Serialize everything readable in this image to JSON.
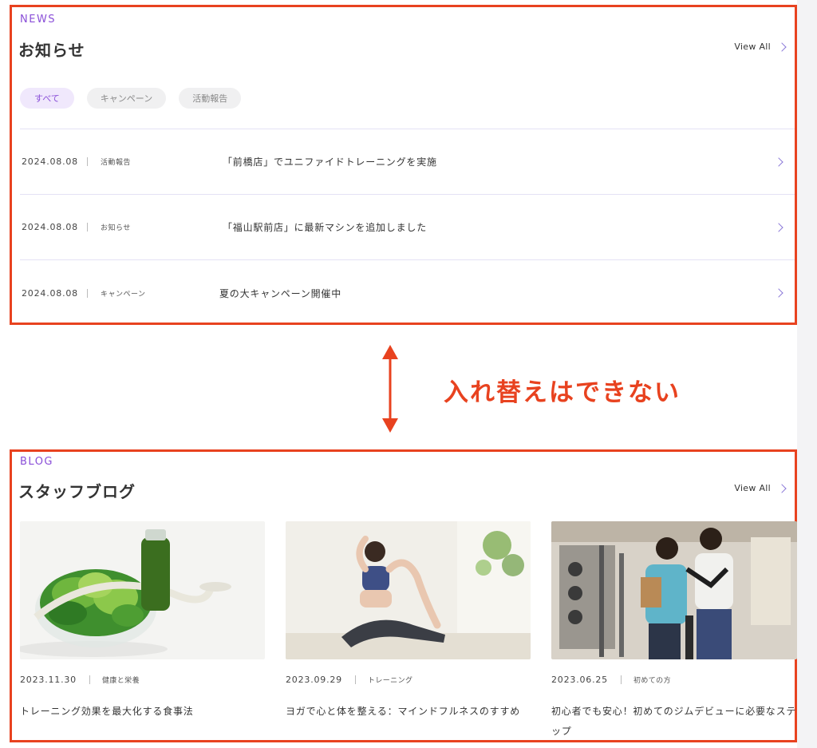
{
  "news": {
    "eyebrow": "NEWS",
    "title": "お知らせ",
    "view_all": "View All",
    "filters": [
      {
        "label": "すべて",
        "active": true
      },
      {
        "label": "キャンペーン",
        "active": false
      },
      {
        "label": "活動報告",
        "active": false
      }
    ],
    "items": [
      {
        "date": "2024.08.08",
        "category": "活動報告",
        "title": "「前橋店」でユニファイドトレーニングを実施"
      },
      {
        "date": "2024.08.08",
        "category": "お知らせ",
        "title": "「福山駅前店」に最新マシンを追加しました"
      },
      {
        "date": "2024.08.08",
        "category": "キャンペーン",
        "title": "夏の大キャンペーン開催中"
      }
    ]
  },
  "annotation": {
    "text": "入れ替えはできない",
    "color": "#e8421f"
  },
  "blog": {
    "eyebrow": "BLOG",
    "title": "スタッフブログ",
    "view_all": "View All",
    "posts": [
      {
        "date": "2023.11.30",
        "category": "健康と栄養",
        "title": "トレーニング効果を最大化する食事法",
        "image": "salad-and-measuring-tape-photo"
      },
      {
        "date": "2023.09.29",
        "category": "トレーニング",
        "title": "ヨガで心と体を整える：マインドフルネスのすすめ",
        "image": "yoga-pose-photo"
      },
      {
        "date": "2023.06.25",
        "category": "初めての方",
        "title": "初心者でも安心！初めてのジムデビューに必要なステップ",
        "image": "gym-trainer-photo"
      }
    ]
  },
  "colors": {
    "accent": "#8a4fd8",
    "frame": "#e8421f",
    "divider": "#e4e2f5"
  }
}
